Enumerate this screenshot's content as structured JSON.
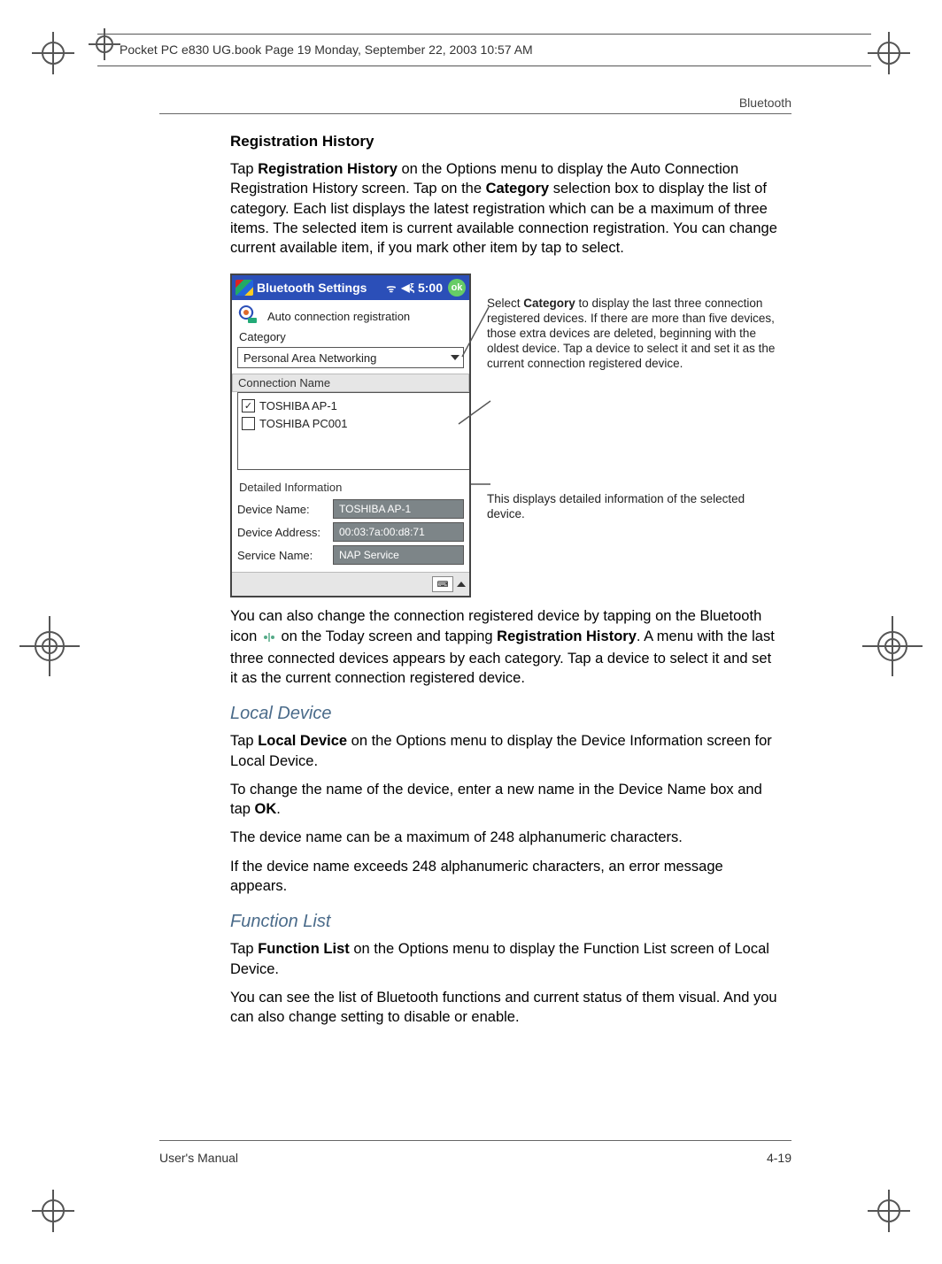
{
  "header": {
    "bookinfo": "Pocket PC e830 UG.book  Page 19  Monday, September 22, 2003  10:57 AM"
  },
  "runhead": "Bluetooth",
  "section": {
    "title": "Registration History",
    "para1_a": "Tap ",
    "para1_b": "Registration History",
    "para1_c": " on the Options menu to display the Auto Connection Registration History screen. Tap on the ",
    "para1_d": "Category",
    "para1_e": " selection box to display the list of category. Each list displays the latest registration which can be a maximum of three items. The selected item is current available connection registration. You can change current available item, if you mark other item by tap to select."
  },
  "pda": {
    "title": "Bluetooth Settings",
    "time": "5:00",
    "ok": "ok",
    "autoconn": "Auto connection registration",
    "cat_label": "Category",
    "cat_value": "Personal Area Networking",
    "conn_header": "Connection Name",
    "items": [
      {
        "label": "TOSHIBA AP-1",
        "checked": true
      },
      {
        "label": "TOSHIBA PC001",
        "checked": false
      }
    ],
    "det_header": "Detailed Information",
    "kv": [
      {
        "k": "Device Name:",
        "v": "TOSHIBA AP-1"
      },
      {
        "k": "Device Address:",
        "v": "00:03:7a:00:d8:71"
      },
      {
        "k": "Service Name:",
        "v": "NAP Service"
      }
    ]
  },
  "callouts": {
    "c1_a": "Select ",
    "c1_b": "Category",
    "c1_c": " to display the last three connection registered devices. If there are more than five devices, those extra devices are deleted, beginning with the oldest device. Tap a device to select it and set it as the current connection registered device.",
    "c2": "This displays detailed information of the selected device."
  },
  "after": {
    "p_a": "You can also change the connection registered device by tapping on the Bluetooth icon ",
    "p_b": " on the Today screen and tapping ",
    "p_c": "Registration History",
    "p_d": ". A menu with the last three connected devices appears by each category. Tap a device to select it and set it as the current connection registered device."
  },
  "local": {
    "head": "Local Device",
    "p1_a": "Tap ",
    "p1_b": "Local Device",
    "p1_c": " on the Options menu to display the Device Information screen for Local Device.",
    "p2_a": "To change the name of the device, enter a new name in the Device Name box and tap ",
    "p2_b": "OK",
    "p2_c": ".",
    "p3": "The device name can be a maximum of 248 alphanumeric characters.",
    "p4": "If the device name exceeds 248 alphanumeric characters, an error message appears."
  },
  "func": {
    "head": "Function List",
    "p1_a": "Tap ",
    "p1_b": "Function List",
    "p1_c": " on the Options menu to display the Function List screen of Local Device.",
    "p2": "You can see the list of Bluetooth functions and current status of them visual. And you can also change setting to disable or enable."
  },
  "footer": {
    "left": "User's Manual",
    "right": "4-19"
  }
}
